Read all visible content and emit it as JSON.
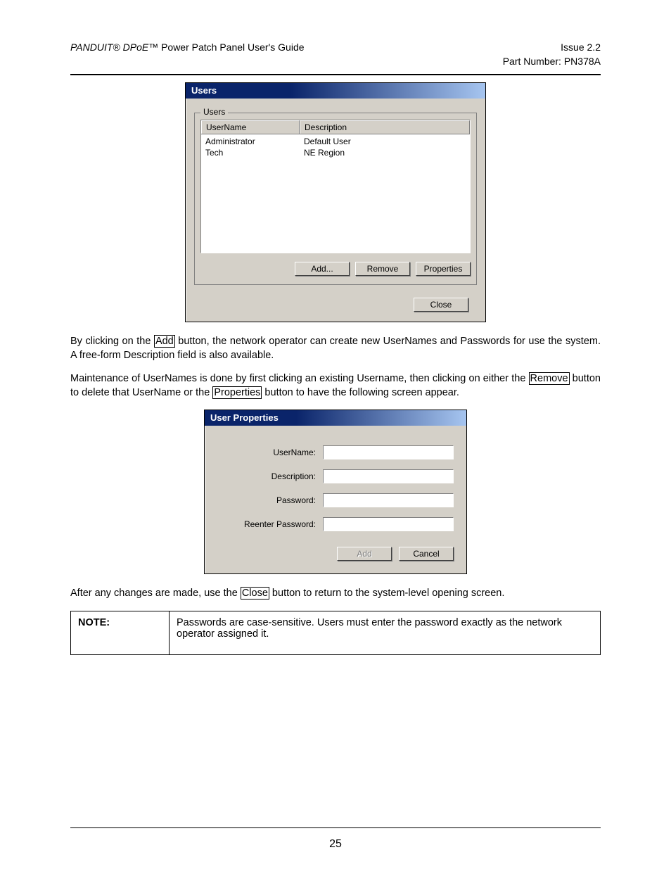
{
  "header": {
    "product_brand": "PANDUIT® DPoE™",
    "product_title_rest": " Power Patch Panel User's Guide",
    "issue": "Issue 2.2",
    "part_number": "Part Number: PN378A"
  },
  "users_window": {
    "title": "Users",
    "group_label": "Users",
    "columns": {
      "c1": "UserName",
      "c2": "Description"
    },
    "rows": [
      {
        "c1": "Administrator",
        "c2": "Default User"
      },
      {
        "c1": "Tech",
        "c2": "NE Region"
      }
    ],
    "buttons": {
      "add": "Add...",
      "remove": "Remove",
      "properties": "Properties",
      "close": "Close"
    }
  },
  "para1_parts": {
    "p1": "By clicking on the ",
    "add": "Add",
    "p2": " button, the network operator can create new UserNames and Passwords for use the system.  A free-form Description field is also available."
  },
  "para2_parts": {
    "p1": "Maintenance of UserNames is done by first clicking an existing Username, then clicking on either the ",
    "remove": "Remove",
    "p2": " button to delete that UserName or the ",
    "properties": "Properties",
    "p3": " button to have the following screen appear."
  },
  "props_window": {
    "title": "User Properties",
    "labels": {
      "username": "UserName:",
      "description": "Description:",
      "password": "Password:",
      "reenter": "Reenter Password:"
    },
    "buttons": {
      "add": "Add",
      "cancel": "Cancel"
    }
  },
  "para3_parts": {
    "p1": "After any changes are made, use the ",
    "close": "Close",
    "p2": " button to return to the system-level opening screen."
  },
  "note": {
    "label": "NOTE:",
    "text": "Passwords are case-sensitive.  Users must enter the password exactly as the network operator assigned it."
  },
  "page_number": "25"
}
